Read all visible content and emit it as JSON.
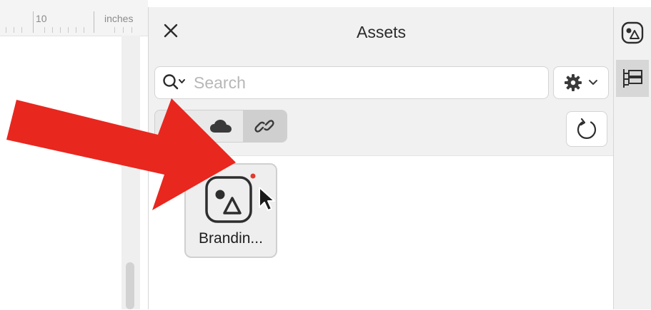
{
  "ruler": {
    "number": "10",
    "unit": "inches"
  },
  "panel": {
    "title": "Assets",
    "search_placeholder": "Search"
  },
  "filters": [
    {
      "icon": "hierarchy-icon",
      "active": false
    },
    {
      "icon": "cloud-icon",
      "active": false
    },
    {
      "icon": "link-icon",
      "active": true
    }
  ],
  "assets": [
    {
      "label": "Brandin...",
      "icon": "linked-shapes-asset-icon",
      "badge": "red-status-dot"
    }
  ],
  "right_strip": [
    {
      "icon": "assets-shapes-icon",
      "active": false
    },
    {
      "icon": "layers-tree-icon",
      "active": true
    }
  ],
  "colors": {
    "annotation_arrow": "#e8271f",
    "panel_bg": "#f1f1f1",
    "active_filter": "#cfcfcf"
  }
}
